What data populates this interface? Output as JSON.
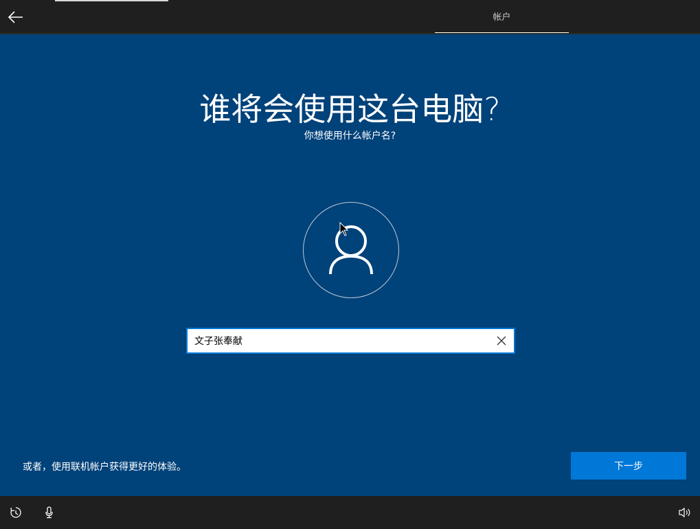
{
  "header": {
    "back_icon": "arrow-left-icon",
    "tab_label": "帐户"
  },
  "main": {
    "title": "谁将会使用这台电脑?",
    "subtitle": "你想使用什么帐户名?",
    "avatar_icon": "user-icon",
    "name_input": {
      "value": "文子张奉献",
      "clear_icon": "close-icon"
    },
    "online_account_link": "或者，使用联机帐户获得更好的体验。",
    "next_button_label": "下一步"
  },
  "footer": {
    "icons": [
      "ease-of-access-icon",
      "microphone-icon",
      "volume-icon"
    ]
  },
  "colors": {
    "background": "#00427a",
    "bar": "#1f1f1f",
    "accent": "#0078d7"
  }
}
